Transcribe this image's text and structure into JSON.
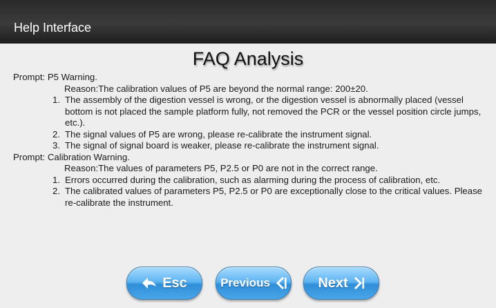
{
  "header": {
    "title": "Help Interface"
  },
  "page": {
    "title": "FAQ Analysis"
  },
  "faq": [
    {
      "prompt": "Prompt: P5 Warning.",
      "reason": "Reason:The calibration values of P5 are beyond the normal range: 200±20.",
      "items": [
        {
          "num": "1.",
          "text": "The assembly of the digestion vessel is wrong, or the digestion vessel is abnormally placed (vessel bottom is not placed the sample platform fully, not removed the PCR or the vessel position circle jumps, etc.)."
        },
        {
          "num": "2.",
          "text": "The signal values of P5 are wrong, please re-calibrate the instrument signal."
        },
        {
          "num": "3.",
          "text": "The signal of signal board is weaker, please re-calibrate the instrument signal."
        }
      ]
    },
    {
      "prompt": "Prompt: Calibration Warning.",
      "reason": "Reason:The values of parameters P5, P2.5 or P0 are not in the correct range.",
      "items": [
        {
          "num": "1.",
          "text": " Errors occurred during the calibration, such as alarming during the process of calibration, etc."
        },
        {
          "num": "2.",
          "text": "The calibrated values of parameters P5, P2.5 or P0 are exceptionally close to the critical values. Please re-calibrate the instrument."
        }
      ]
    }
  ],
  "buttons": {
    "esc_label": "Esc",
    "prev_label": "Previous",
    "next_label": "Next",
    "esc_icon": "arrow-left-icon",
    "prev_icon": "chevron-left-bar-icon",
    "next_icon": "chevron-right-bar-icon"
  },
  "colors": {
    "titlebar": "#2e2e2e",
    "background": "#eeeeee",
    "button_blue": "#4aa6ea"
  }
}
